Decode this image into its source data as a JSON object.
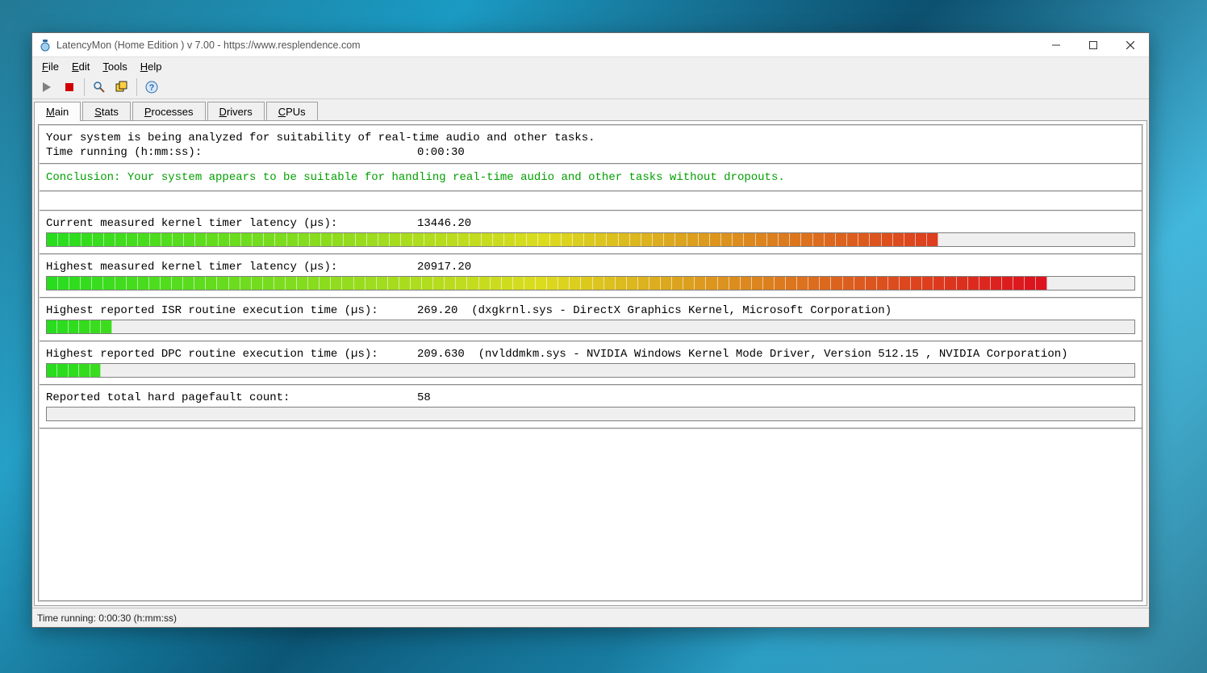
{
  "window": {
    "title": "LatencyMon  (Home Edition )  v 7.00 - https://www.resplendence.com"
  },
  "menu": {
    "file": "File",
    "edit": "Edit",
    "tools": "Tools",
    "help": "Help"
  },
  "toolbar_icons": {
    "play": "play-icon",
    "stop": "stop-icon",
    "find": "find-icon",
    "windows": "windows-icon",
    "help": "help-icon"
  },
  "tabs": {
    "main": "Main",
    "stats": "Stats",
    "processes": "Processes",
    "drivers": "Drivers",
    "cpus": "CPUs",
    "active": "main"
  },
  "intro": {
    "line1": "Your system is being analyzed for suitability of real-time audio and other tasks.",
    "time_label": "Time running (h:mm:ss):",
    "time_value": "0:00:30"
  },
  "conclusion": "Conclusion: Your system appears to be suitable for handling real-time audio and other tasks without dropouts.",
  "metrics": {
    "kernel_current": {
      "label": "Current measured kernel timer latency (µs):",
      "value": "13446.20",
      "bar_percent": 82,
      "segments": 78
    },
    "kernel_highest": {
      "label": "Highest measured kernel timer latency (µs):",
      "value": "20917.20",
      "bar_percent": 92,
      "segments": 88
    },
    "isr": {
      "label": "Highest reported ISR routine execution time (µs):",
      "value": "269.20  (dxgkrnl.sys - DirectX Graphics Kernel, Microsoft Corporation)",
      "bar_percent": 6,
      "segments": 6
    },
    "dpc": {
      "label": "Highest reported DPC routine execution time (µs):",
      "value": "209.630  (nvlddmkm.sys - NVIDIA Windows Kernel Mode Driver, Version 512.15 , NVIDIA Corporation)",
      "bar_percent": 5,
      "segments": 5
    },
    "pagefault": {
      "label": "Reported total hard pagefault count:",
      "value": "58"
    }
  },
  "statusbar": "Time running: 0:00:30  (h:mm:ss)"
}
